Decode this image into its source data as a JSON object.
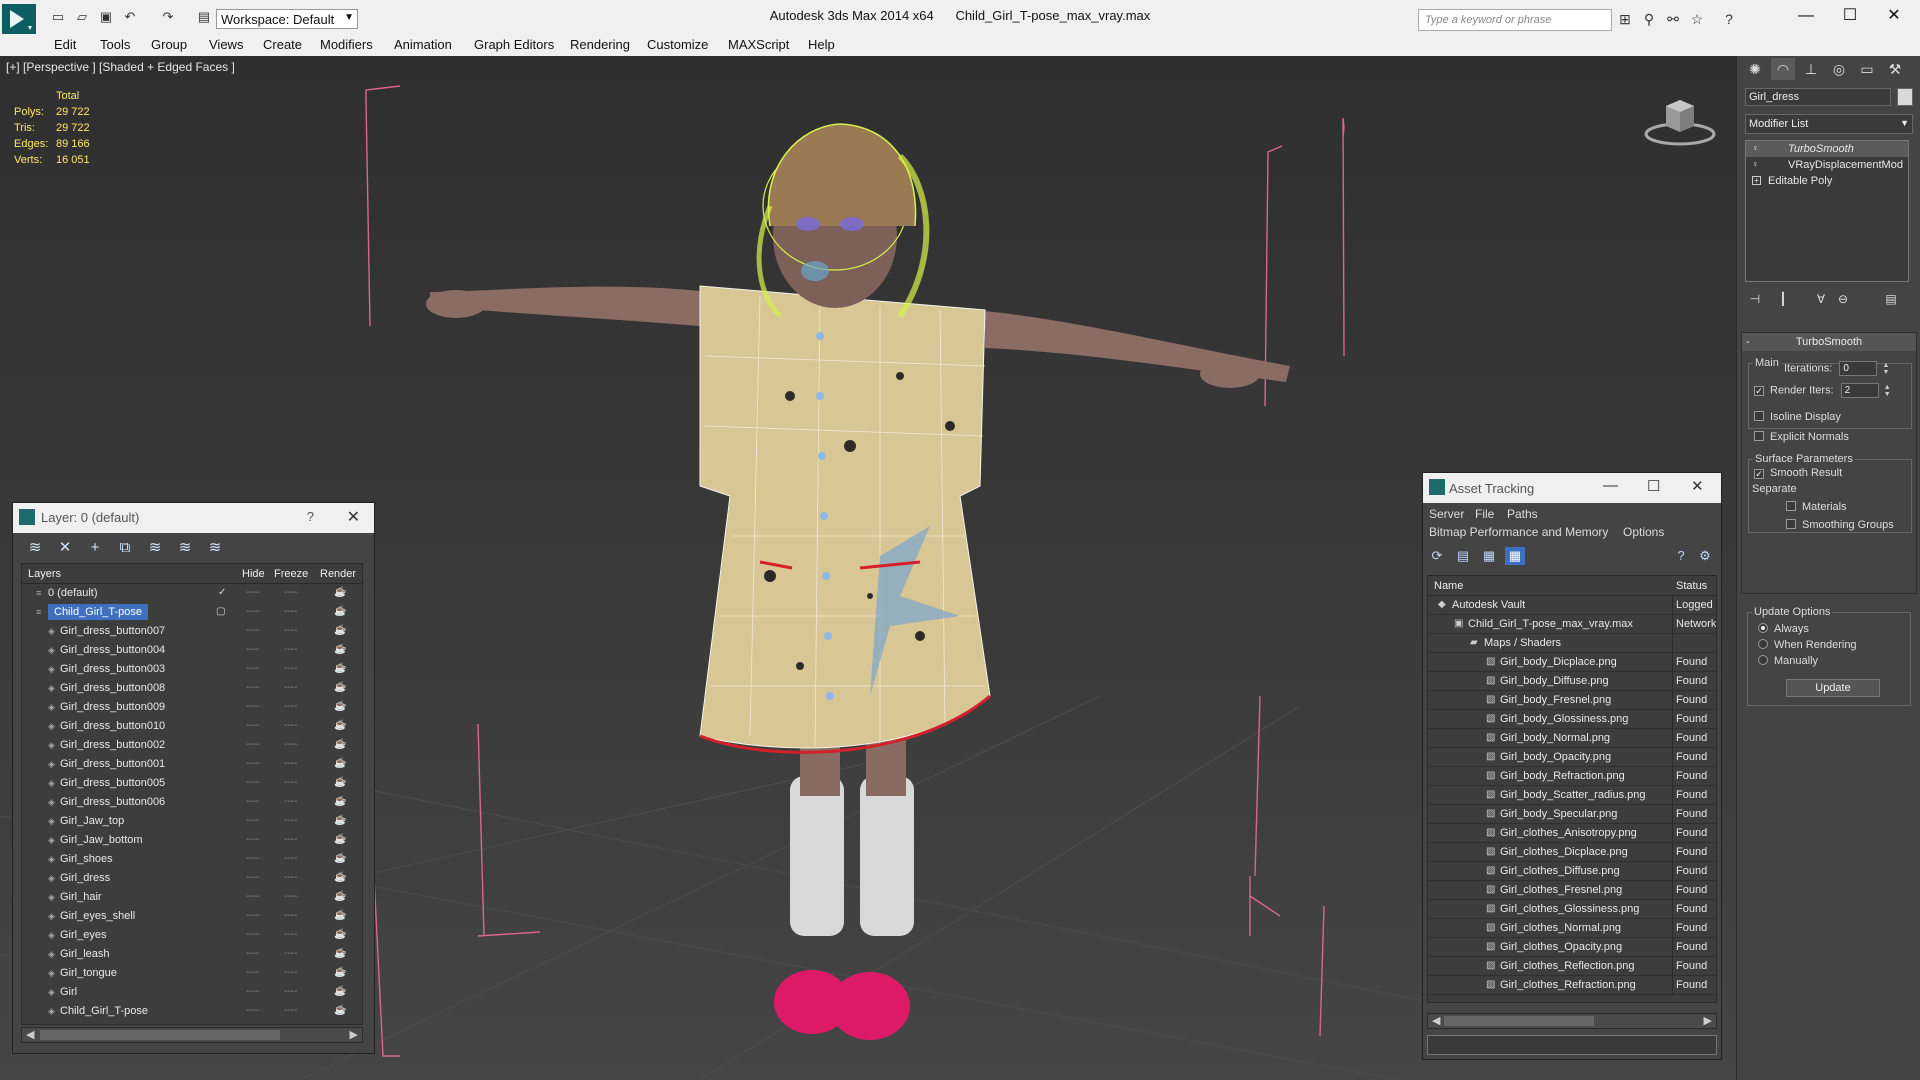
{
  "titlebar": {
    "workspace": "Workspace: Default",
    "app_name": "Autodesk 3ds Max  2014 x64",
    "file_name": "Child_Girl_T-pose_max_vray.max",
    "search_placeholder": "Type a keyword or phrase"
  },
  "menu": [
    "Edit",
    "Tools",
    "Group",
    "Views",
    "Create",
    "Modifiers",
    "Animation",
    "Graph Editors",
    "Rendering",
    "Customize",
    "MAXScript",
    "Help"
  ],
  "viewport": {
    "label": "[+] [Perspective ] [Shaded + Edged Faces ]",
    "stats": {
      "total_label": "Total",
      "rows": [
        {
          "key": "Polys:",
          "value": "29 722"
        },
        {
          "key": "Tris:",
          "value": "29 722"
        },
        {
          "key": "Edges:",
          "value": "89 166"
        },
        {
          "key": "Verts:",
          "value": "16 051"
        }
      ]
    }
  },
  "layer_panel": {
    "title": "Layer: 0 (default)",
    "help": "?",
    "columns": {
      "layers": "Layers",
      "hide": "Hide",
      "freeze": "Freeze",
      "render": "Render"
    },
    "rows": [
      {
        "name": "0 (default)",
        "level": 0,
        "current": true
      },
      {
        "name": "Child_Girl_T-pose",
        "level": 0,
        "selected": true
      },
      {
        "name": "Girl_dress_button007",
        "level": 1
      },
      {
        "name": "Girl_dress_button004",
        "level": 1
      },
      {
        "name": "Girl_dress_button003",
        "level": 1
      },
      {
        "name": "Girl_dress_button008",
        "level": 1
      },
      {
        "name": "Girl_dress_button009",
        "level": 1
      },
      {
        "name": "Girl_dress_button010",
        "level": 1
      },
      {
        "name": "Girl_dress_button002",
        "level": 1
      },
      {
        "name": "Girl_dress_button001",
        "level": 1
      },
      {
        "name": "Girl_dress_button005",
        "level": 1
      },
      {
        "name": "Girl_dress_button006",
        "level": 1
      },
      {
        "name": "Girl_Jaw_top",
        "level": 1
      },
      {
        "name": "Girl_Jaw_bottom",
        "level": 1
      },
      {
        "name": "Girl_shoes",
        "level": 1
      },
      {
        "name": "Girl_dress",
        "level": 1
      },
      {
        "name": "Girl_hair",
        "level": 1
      },
      {
        "name": "Girl_eyes_shell",
        "level": 1
      },
      {
        "name": "Girl_eyes",
        "level": 1
      },
      {
        "name": "Girl_leash",
        "level": 1
      },
      {
        "name": "Girl_tongue",
        "level": 1
      },
      {
        "name": "Girl",
        "level": 1
      },
      {
        "name": "Child_Girl_T-pose",
        "level": 1
      }
    ]
  },
  "asset_tracking": {
    "title": "Asset Tracking",
    "menu": [
      "Server",
      "File",
      "Paths",
      "Bitmap Performance and Memory",
      "Options"
    ],
    "columns": {
      "name": "Name",
      "status": "Status"
    },
    "rows": [
      {
        "name": "Autodesk Vault",
        "status": "Logged",
        "level": 0
      },
      {
        "name": "Child_Girl_T-pose_max_vray.max",
        "status": "Network",
        "level": 1
      },
      {
        "name": "Maps / Shaders",
        "status": "",
        "level": 2
      },
      {
        "name": "Girl_body_Dicplace.png",
        "status": "Found",
        "level": 3
      },
      {
        "name": "Girl_body_Diffuse.png",
        "status": "Found",
        "level": 3
      },
      {
        "name": "Girl_body_Fresnel.png",
        "status": "Found",
        "level": 3
      },
      {
        "name": "Girl_body_Glossiness.png",
        "status": "Found",
        "level": 3
      },
      {
        "name": "Girl_body_Normal.png",
        "status": "Found",
        "level": 3
      },
      {
        "name": "Girl_body_Opacity.png",
        "status": "Found",
        "level": 3
      },
      {
        "name": "Girl_body_Refraction.png",
        "status": "Found",
        "level": 3
      },
      {
        "name": "Girl_body_Scatter_radius.png",
        "status": "Found",
        "level": 3
      },
      {
        "name": "Girl_body_Specular.png",
        "status": "Found",
        "level": 3
      },
      {
        "name": "Girl_clothes_Anisotropy.png",
        "status": "Found",
        "level": 3
      },
      {
        "name": "Girl_clothes_Dicplace.png",
        "status": "Found",
        "level": 3
      },
      {
        "name": "Girl_clothes_Diffuse.png",
        "status": "Found",
        "level": 3
      },
      {
        "name": "Girl_clothes_Fresnel.png",
        "status": "Found",
        "level": 3
      },
      {
        "name": "Girl_clothes_Glossiness.png",
        "status": "Found",
        "level": 3
      },
      {
        "name": "Girl_clothes_Normal.png",
        "status": "Found",
        "level": 3
      },
      {
        "name": "Girl_clothes_Opacity.png",
        "status": "Found",
        "level": 3
      },
      {
        "name": "Girl_clothes_Reflection.png",
        "status": "Found",
        "level": 3
      },
      {
        "name": "Girl_clothes_Refraction.png",
        "status": "Found",
        "level": 3
      }
    ]
  },
  "command_panel": {
    "object_name": "Girl_dress",
    "modifier_list": "Modifier List",
    "stack": [
      {
        "name": "TurboSmooth",
        "active": true
      },
      {
        "name": "VRayDisplacementMod",
        "active": false
      },
      {
        "name": "Editable Poly",
        "active": false
      }
    ],
    "turbosmooth": {
      "title": "TurboSmooth",
      "main_label": "Main",
      "iterations_label": "Iterations:",
      "iterations_value": "0",
      "render_iters_label": "Render Iters:",
      "render_iters_value": "2",
      "isoline_label": "Isoline Display",
      "explicit_normals_label": "Explicit Normals",
      "surface_label": "Surface Parameters",
      "smooth_result_label": "Smooth Result",
      "separate_label": "Separate",
      "materials_label": "Materials",
      "smoothing_groups_label": "Smoothing Groups",
      "update_options_label": "Update Options",
      "always_label": "Always",
      "when_rendering_label": "When Rendering",
      "manually_label": "Manually",
      "update_button": "Update"
    }
  },
  "colors": {
    "viewport_bg": "#353535",
    "bounding_box": "#d9668f",
    "selection_blue": "#3f6fbf",
    "stats_yellow": "#ffe66a",
    "hair_wire": "#d6f24a"
  }
}
